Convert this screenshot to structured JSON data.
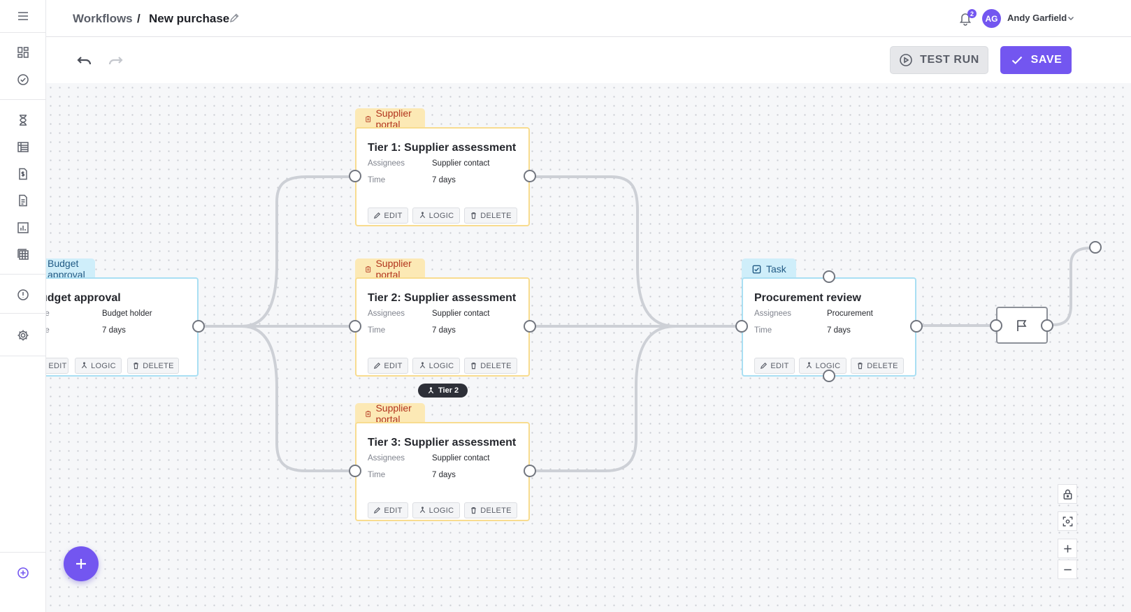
{
  "breadcrumb": {
    "root": "Workflows",
    "separator": "/",
    "current": "New purchase"
  },
  "notifications": {
    "count": "2"
  },
  "user": {
    "initials": "AG",
    "name": "Andy Garfield"
  },
  "toolbar": {
    "test_run_label": "TEST RUN",
    "save_label": "SAVE"
  },
  "buttons": {
    "edit": "EDIT",
    "logic": "LOGIC",
    "delete": "DELETE"
  },
  "labels": {
    "assignees": "Assignees",
    "time": "Time",
    "type_partial": "pe",
    "time_partial": "ne"
  },
  "nodes": {
    "budget": {
      "tag": "Budget approval",
      "title": "udget approval",
      "assignee": "Budget holder",
      "time": "7 days"
    },
    "tier1": {
      "tag": "Supplier portal",
      "title": "Tier 1: Supplier assessment",
      "assignee": "Supplier contact",
      "time": "7 days"
    },
    "tier2": {
      "tag": "Supplier portal",
      "title": "Tier 2: Supplier assessment",
      "assignee": "Supplier contact",
      "time": "7 days"
    },
    "tier3": {
      "tag": "Supplier portal",
      "title": "Tier 3: Supplier assessment",
      "assignee": "Supplier contact",
      "time": "7 days"
    },
    "review": {
      "tag": "Task",
      "title": "Procurement review",
      "assignee": "Procurement",
      "time": "7 days"
    }
  },
  "edge_label": "Tier 2",
  "colors": {
    "accent": "#7356f0",
    "portal_tag_bg": "#fce9b5",
    "portal_tag_text": "#b2341d",
    "task_tag_bg": "#cfeefa",
    "edge": "#cdd0d6"
  }
}
